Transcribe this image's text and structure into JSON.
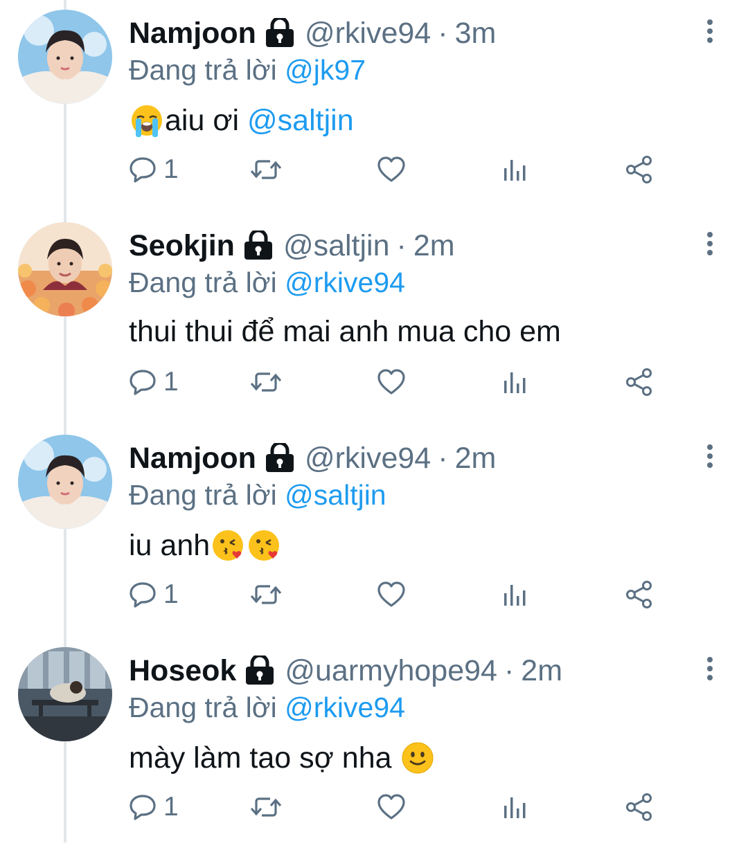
{
  "tweets": [
    {
      "name": "Namjoon",
      "handle": "@rkive94",
      "separator": "·",
      "time": "3m",
      "reply_prefix": "Đang trả lời",
      "reply_to": "@jk97",
      "text_before": "",
      "leading_emoji": "loudly-crying-face",
      "text_main": "aiu ơi ",
      "text_mention": "@saltjin",
      "trailing_emojis": [],
      "reply_count": "1",
      "avatar": "avatar-photo-pink-blue"
    },
    {
      "name": "Seokjin",
      "handle": "@saltjin",
      "separator": "·",
      "time": "2m",
      "reply_prefix": "Đang trả lời",
      "reply_to": "@rkive94",
      "text_before": "",
      "leading_emoji": "",
      "text_main": "thui thui để mai anh mua cho em",
      "text_mention": "",
      "trailing_emojis": [],
      "reply_count": "1",
      "avatar": "avatar-photo-flowers"
    },
    {
      "name": "Namjoon",
      "handle": "@rkive94",
      "separator": "·",
      "time": "2m",
      "reply_prefix": "Đang trả lời",
      "reply_to": "@saltjin",
      "text_before": "",
      "leading_emoji": "",
      "text_main": "iu anh",
      "text_mention": "",
      "trailing_emojis": [
        "face-blowing-kiss",
        "face-blowing-kiss"
      ],
      "reply_count": "1",
      "avatar": "avatar-photo-pink-blue"
    },
    {
      "name": "Hoseok",
      "handle": "@uarmyhope94",
      "separator": "·",
      "time": "2m",
      "reply_prefix": "Đang trả lời",
      "reply_to": "@rkive94",
      "text_before": "",
      "leading_emoji": "",
      "text_main": "mày làm tao sợ nha ",
      "text_mention": "",
      "trailing_emojis": [
        "slightly-smiling-face"
      ],
      "reply_count": "1",
      "avatar": "avatar-photo-dark-room"
    }
  ],
  "colors": {
    "text": "#0f1419",
    "secondary": "#5b7083",
    "mention": "#1d9bf0",
    "thread_line": "#e1e6ea"
  },
  "icons": {
    "lock": "lock-icon",
    "more": "more-vertical-icon",
    "reply": "reply-icon",
    "retweet": "retweet-icon",
    "like": "heart-icon",
    "analytics": "analytics-icon",
    "share": "share-icon"
  }
}
